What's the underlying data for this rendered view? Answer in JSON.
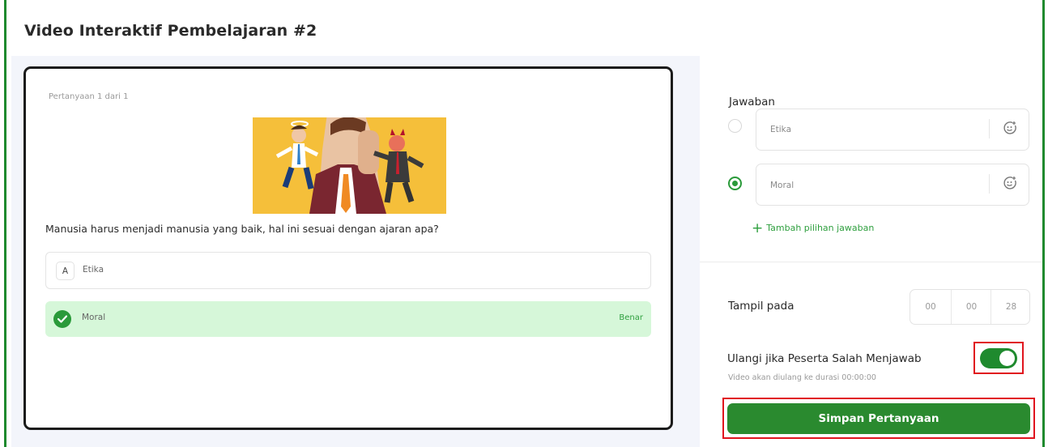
{
  "page": {
    "title": "Video Interaktif Pembelajaran #2"
  },
  "preview": {
    "counter": "Pertanyaan 1 dari 1",
    "question": "Manusia harus menjadi manusia yang baik, hal ini sesuai dengan ajaran apa?",
    "options": [
      {
        "letter": "A",
        "label": "Etika"
      },
      {
        "label": "Moral",
        "status": "Benar"
      }
    ]
  },
  "editor": {
    "answers_label": "Jawaban",
    "answers": [
      {
        "text": "Etika",
        "selected": false
      },
      {
        "text": "Moral",
        "selected": true
      }
    ],
    "add_answer": "Tambah pilihan jawaban",
    "show_at_label": "Tampil pada",
    "show_at": {
      "hh": "00",
      "mm": "00",
      "ss": "28"
    },
    "repeat_label": "Ulangi jika Peserta Salah Menjawab",
    "repeat_hint": "Video akan diulang ke durasi 00:00:00",
    "repeat_enabled": true,
    "save_label": "Simpan Pertanyaan"
  },
  "colors": {
    "accent": "#2a8a2f",
    "frame": "#1f8a2e",
    "correct_bg": "#d6f7d9",
    "highlight": "#e0141e",
    "image_bg": "#f5bf3a"
  }
}
